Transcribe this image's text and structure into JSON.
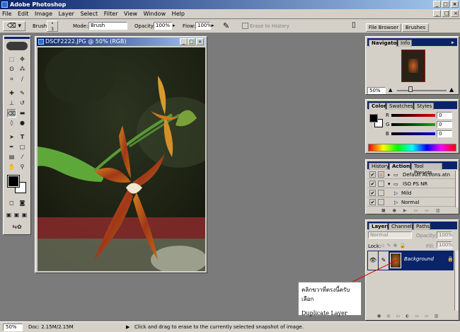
{
  "window": {
    "title": "Adobe Photoshop",
    "min": "_",
    "max": "□",
    "close": "×"
  },
  "menu": [
    "File",
    "Edit",
    "Image",
    "Layer",
    "Select",
    "Filter",
    "View",
    "Window",
    "Help"
  ],
  "options": {
    "brush_label": "Brush:",
    "brush_size": "3",
    "mode_label": "Mode:",
    "mode_value": "Brush",
    "opacity_label": "Opacity:",
    "opacity_value": "100%",
    "flow_label": "Flow:",
    "flow_value": "100%",
    "erase_to_history": "Erase to History",
    "well_tabs": [
      "File Browser",
      "Brushes"
    ]
  },
  "document": {
    "title": "DSCF2222.JPG @ 50% (RGB)"
  },
  "navigator": {
    "tabs": [
      "Navigator",
      "Info"
    ],
    "zoom": "50%"
  },
  "color": {
    "tabs": [
      "Color",
      "Swatches",
      "Styles"
    ],
    "channels": [
      {
        "label": "R",
        "value": "0",
        "color": "#e00000"
      },
      {
        "label": "G",
        "value": "0",
        "color": "#00b000"
      },
      {
        "label": "B",
        "value": "0",
        "color": "#0000d0"
      }
    ]
  },
  "actions": {
    "tabs": [
      "History",
      "Actions",
      "Tool Presets"
    ],
    "items": [
      "Default Actions.atn",
      "ISO PS NR",
      "Mild",
      "Normal"
    ]
  },
  "layers": {
    "tabs": [
      "Layers",
      "Channels",
      "Paths"
    ],
    "blend_mode": "Normal",
    "opacity_label": "Opacity:",
    "opacity_value": "100%",
    "lock_label": "Lock:",
    "fill_label": "Fill:",
    "fill_value": "100%",
    "layer_name": "Background"
  },
  "callout": {
    "line1": "คลิกขวาที่ตรงนี้ครับ เลือก",
    "line2": "Duplicate Layer"
  },
  "status": {
    "zoom": "50%",
    "doc": "Doc: 2.15M/2.15M",
    "hint": "Click and drag to erase to the currently selected snapshot of image."
  }
}
